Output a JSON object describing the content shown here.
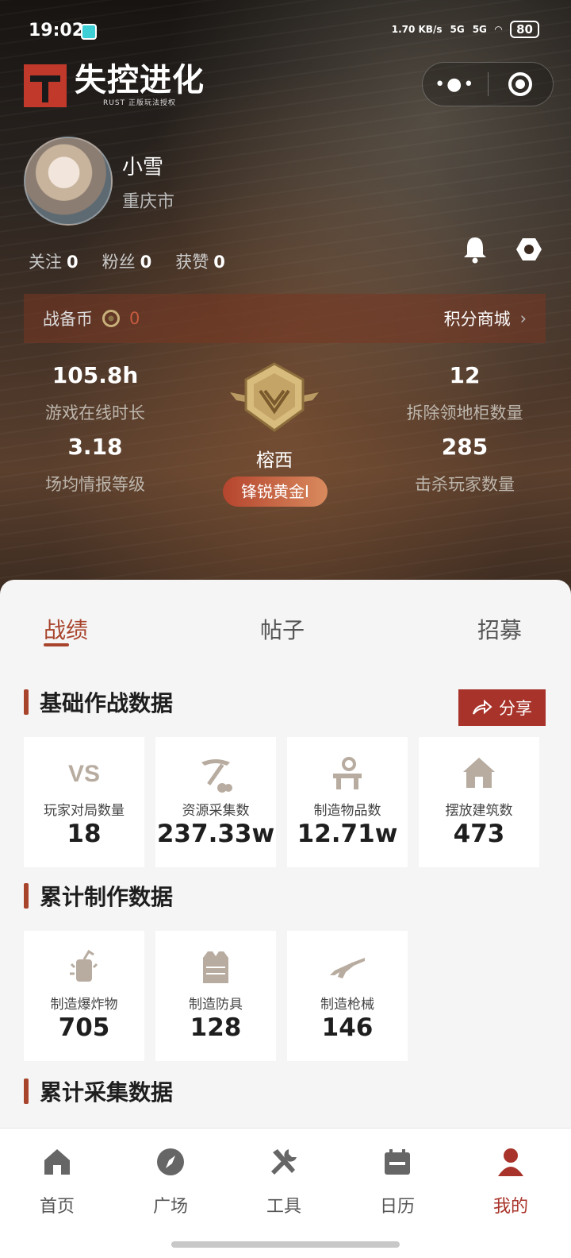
{
  "status_bar": {
    "time": "19:02",
    "net_speed": "1.70 KB/s",
    "signal_1": "5G",
    "signal_2": "5G",
    "battery": "80"
  },
  "header": {
    "app_logo_text": "失控进化",
    "app_logo_sub": "RUST 正版玩法授权"
  },
  "profile": {
    "name": "小雪",
    "city": "重庆市",
    "follow_label": "关注",
    "follow_count": "0",
    "fans_label": "粉丝",
    "fans_count": "0",
    "likes_label": "获赞",
    "likes_count": "0"
  },
  "coin_bar": {
    "label": "战备币",
    "value": "0",
    "shop_label": "积分商城"
  },
  "stats": {
    "online_hours": {
      "value": "105.8h",
      "label": "游戏在线时长"
    },
    "intel_level": {
      "value": "3.18",
      "label": "场均情报等级"
    },
    "cabinets_removed": {
      "value": "12",
      "label": "拆除领地柜数量"
    },
    "players_killed": {
      "value": "285",
      "label": "击杀玩家数量"
    },
    "region": "榕西",
    "rank": "锋锐黄金I"
  },
  "tabs": [
    {
      "label": "战绩"
    },
    {
      "label": "帖子"
    },
    {
      "label": "招募"
    }
  ],
  "sections": {
    "basic_title": "基础作战数据",
    "share_label": "分享",
    "basic_cards": [
      {
        "icon": "vs-icon",
        "label": "玩家对局数量",
        "value": "18"
      },
      {
        "icon": "pickaxe-icon",
        "label": "资源采集数",
        "value": "237.33w"
      },
      {
        "icon": "crafting-icon",
        "label": "制造物品数",
        "value": "12.71w"
      },
      {
        "icon": "house-icon",
        "label": "摆放建筑数",
        "value": "473"
      }
    ],
    "craft_title": "累计制作数据",
    "craft_cards": [
      {
        "icon": "explosive-icon",
        "label": "制造爆炸物",
        "value": "705"
      },
      {
        "icon": "armor-vest-icon",
        "label": "制造防具",
        "value": "128"
      },
      {
        "icon": "rifle-icon",
        "label": "制造枪械",
        "value": "146"
      }
    ],
    "gather_title": "累计采集数据"
  },
  "nav": [
    {
      "label": "首页",
      "icon": "home-icon"
    },
    {
      "label": "广场",
      "icon": "compass-icon"
    },
    {
      "label": "工具",
      "icon": "tools-icon"
    },
    {
      "label": "日历",
      "icon": "calendar-icon"
    },
    {
      "label": "我的",
      "icon": "profile-icon",
      "active": true
    }
  ],
  "colors": {
    "accent": "#a8332a",
    "coin_value": "#c65a3e",
    "card_icon": "#b8aca0"
  }
}
